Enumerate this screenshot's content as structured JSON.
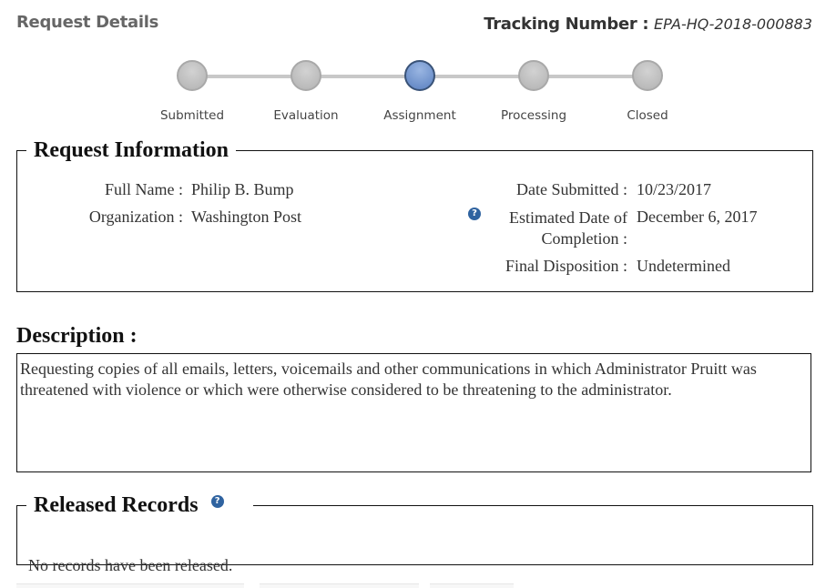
{
  "header": {
    "title": "Request Details",
    "tracking_label": "Tracking Number :",
    "tracking_number": "EPA-HQ-2018-000883"
  },
  "progress": {
    "steps": [
      {
        "label": "Submitted",
        "active": false
      },
      {
        "label": "Evaluation",
        "active": false
      },
      {
        "label": "Assignment",
        "active": true
      },
      {
        "label": "Processing",
        "active": false
      },
      {
        "label": "Closed",
        "active": false
      }
    ],
    "current_step": "Assignment"
  },
  "request_information": {
    "legend": "Request Information",
    "full_name_label": "Full Name :",
    "full_name": "Philip B. Bump",
    "organization_label": "Organization :",
    "organization": "Washington Post",
    "date_submitted_label": "Date Submitted :",
    "date_submitted": "10/23/2017",
    "estimated_completion_label_line1": "Estimated Date of",
    "estimated_completion_label_line2": "Completion :",
    "estimated_completion": "December 6, 2017",
    "final_disposition_label": "Final Disposition :",
    "final_disposition": "Undetermined",
    "help_icon": "question-circle-icon"
  },
  "description": {
    "title": "Description :",
    "text": "Requesting copies of all emails, letters, voicemails and other communications in which Administrator Pruitt was threatened with violence or which were otherwise considered to be threatening to the administrator."
  },
  "released_records": {
    "legend": "Released Records",
    "help_icon": "question-circle-icon",
    "empty_text": "No records have been released."
  },
  "colors": {
    "active_step": "#5a80c0",
    "inactive_step": "#b8b8b8",
    "help_icon": "#2f63a0"
  }
}
